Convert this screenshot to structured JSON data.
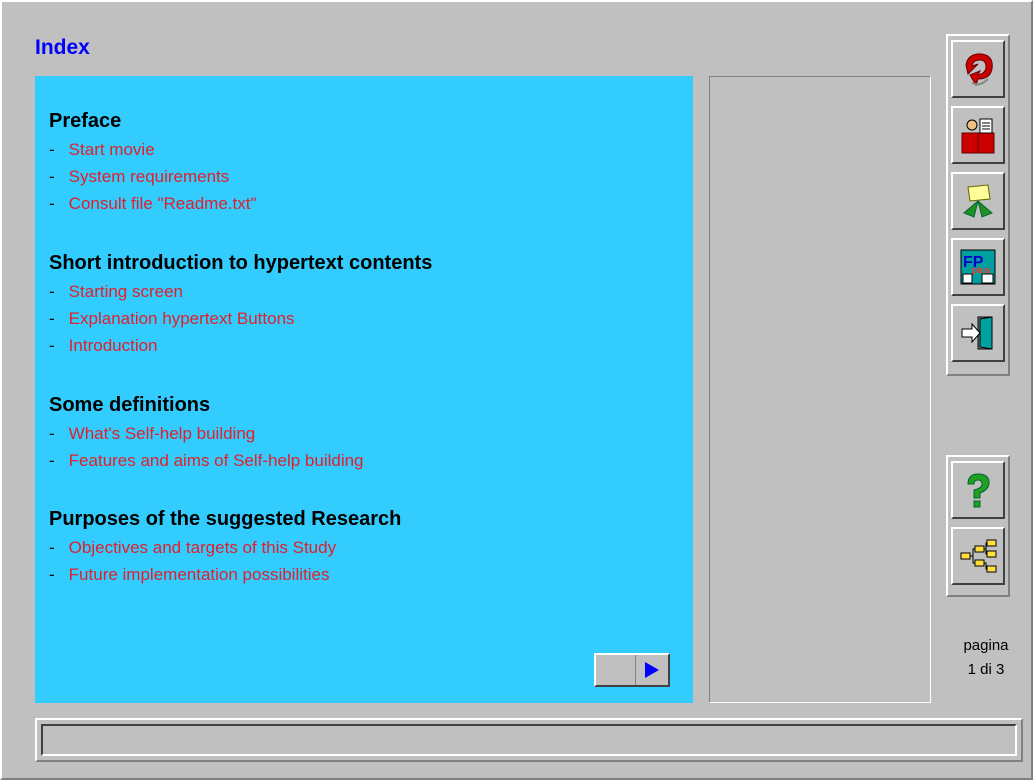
{
  "page": {
    "title": "Index"
  },
  "sections": [
    {
      "heading": "Preface",
      "items": [
        "Start movie",
        "System requirements",
        "Consult file \"Readme.txt\""
      ]
    },
    {
      "heading": "Short introduction to hypertext contents",
      "items": [
        "Starting screen",
        "Explanation hypertext Buttons",
        "Introduction"
      ]
    },
    {
      "heading": "Some definitions",
      "items": [
        "What's Self-help building",
        "Features and aims of Self-help building"
      ]
    },
    {
      "heading": "Purposes of the suggested Research",
      "items": [
        "Objectives and targets of this Study",
        "Future implementation possibilities"
      ]
    }
  ],
  "bullet": "-",
  "toolbar": {
    "top_buttons": [
      "back-arrow-icon",
      "reading-book-icon",
      "recycle-note-icon",
      "fp-logo-icon",
      "exit-door-icon"
    ],
    "bottom_buttons": [
      "help-question-icon",
      "tree-structure-icon"
    ]
  },
  "pager": {
    "label": "pagina",
    "position": "1 di 3"
  },
  "colors": {
    "title": "#0000ff",
    "content_bg": "#33ccff",
    "link": "#e0202a",
    "chrome": "#c0c0c0"
  }
}
